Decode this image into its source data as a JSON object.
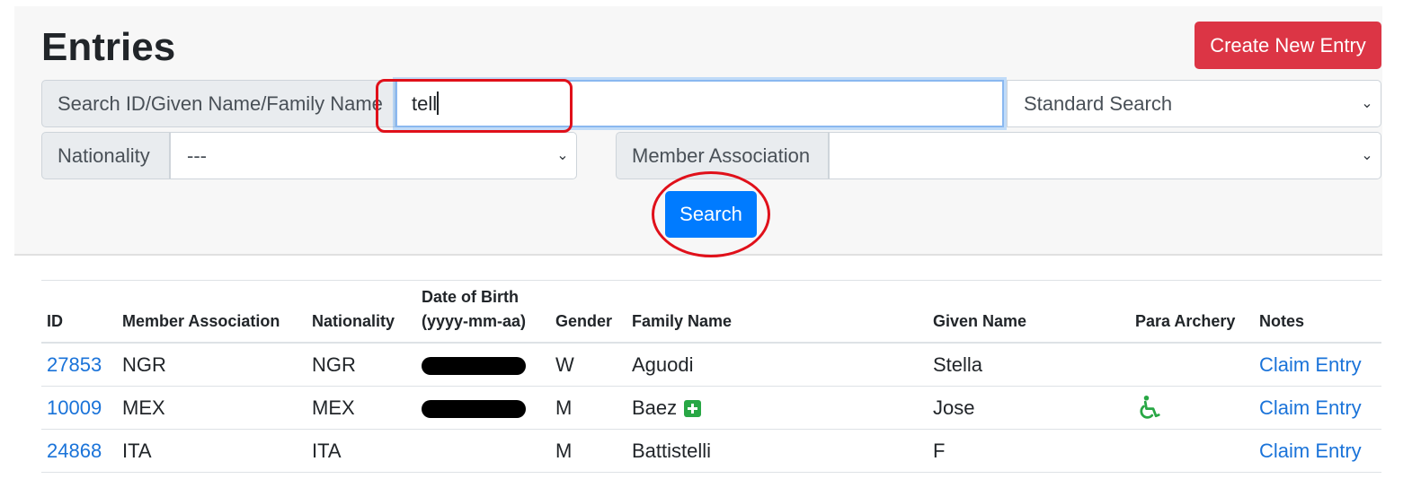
{
  "header": {
    "title": "Entries",
    "create_label": "Create New Entry"
  },
  "search": {
    "label": "Search ID/Given Name/Family Name",
    "value": "tell",
    "mode_selected": "Standard Search",
    "nationality_label": "Nationality",
    "nationality_selected": "---",
    "member_association_label": "Member Association",
    "member_association_selected": "",
    "button_label": "Search"
  },
  "table": {
    "headers": {
      "id": "ID",
      "member_association": "Member Association",
      "nationality": "Nationality",
      "dob_line1": "Date of Birth",
      "dob_line2": "(yyyy-mm-aa)",
      "gender": "Gender",
      "family_name": "Family Name",
      "given_name": "Given Name",
      "para_archery": "Para Archery",
      "notes": "Notes"
    },
    "rows": [
      {
        "id": "27853",
        "member_association": "NGR",
        "nationality": "NGR",
        "gender": "W",
        "family_name": "Aguodi",
        "given_name": "Stella",
        "notes": "Claim Entry"
      },
      {
        "id": "10009",
        "member_association": "MEX",
        "nationality": "MEX",
        "gender": "M",
        "family_name": "Baez",
        "given_name": "Jose",
        "notes": "Claim Entry"
      },
      {
        "id": "24868",
        "member_association": "ITA",
        "nationality": "ITA",
        "gender": "M",
        "family_name": "Battistelli",
        "given_name": "F",
        "notes": "Claim Entry"
      }
    ]
  },
  "colors": {
    "danger": "#dc3545",
    "primary": "#007bff",
    "link": "#1a73d9",
    "success": "#28a745",
    "annotation": "#e0101a"
  },
  "icons": {
    "para": "wheelchair-icon",
    "plus": "plus-square-icon",
    "dropdown": "chevron-down-icon"
  }
}
